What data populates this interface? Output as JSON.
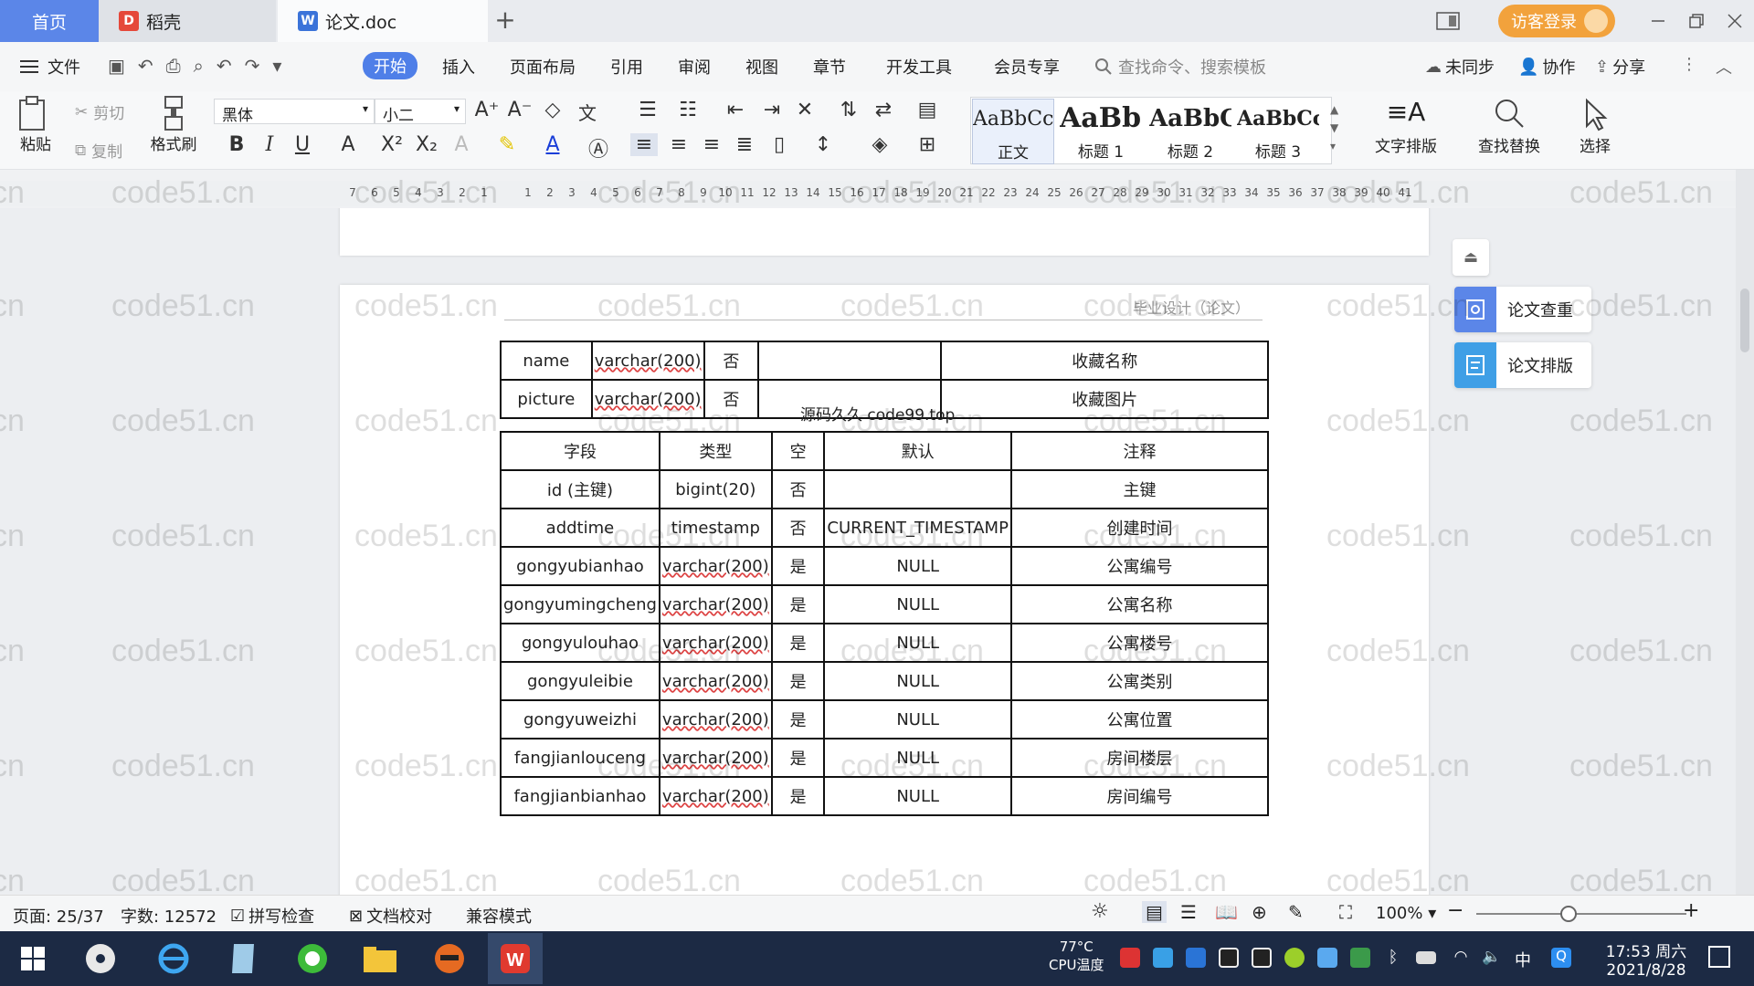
{
  "titlebar": {
    "home_tab": "首页",
    "tabs": [
      {
        "label": "稻壳",
        "icon": "daoke-icon"
      },
      {
        "label": "论文.doc",
        "icon": "word-doc-icon"
      }
    ],
    "new_tab": "+",
    "visitor_login": "访客登录"
  },
  "menu": {
    "file": "文件",
    "items": [
      "开始",
      "插入",
      "页面布局",
      "引用",
      "审阅",
      "视图",
      "章节",
      "开发工具",
      "会员专享"
    ],
    "search_placeholder": "查找命令、搜索模板",
    "sync": "未同步",
    "collab": "协作",
    "share": "分享"
  },
  "ribbon": {
    "paste": "粘贴",
    "cut": "剪切",
    "copy": "复制",
    "format_painter": "格式刷",
    "font": "黑体",
    "size": "小二",
    "styles": [
      {
        "preview": "AaBbCcI",
        "name": "正文"
      },
      {
        "preview": "AaBb(",
        "name": "标题 1"
      },
      {
        "preview": "AaBbC",
        "name": "标题 2"
      },
      {
        "preview": "AaBbCcl",
        "name": "标题 3"
      }
    ],
    "text_layout": "文字排版",
    "find_replace": "查找替换",
    "select": "选择"
  },
  "ruler": [
    "7",
    "6",
    "5",
    "4",
    "3",
    "2",
    "1",
    "",
    "1",
    "2",
    "3",
    "4",
    "5",
    "6",
    "7",
    "8",
    "9",
    "10",
    "11",
    "12",
    "13",
    "14",
    "15",
    "16",
    "17",
    "18",
    "19",
    "20",
    "21",
    "22",
    "23",
    "24",
    "25",
    "26",
    "27",
    "28",
    "29",
    "30",
    "31",
    "32",
    "33",
    "34",
    "35",
    "36",
    "37",
    "38",
    "39",
    "40",
    "41"
  ],
  "document": {
    "header": "毕业设计（论文）",
    "table1": [
      [
        "name",
        "varchar(200)",
        "否",
        "",
        "收藏名称"
      ],
      [
        "picture",
        "varchar(200)",
        "否",
        "",
        "收藏图片"
      ]
    ],
    "caption": "源码久久 code99.top",
    "table2_header": [
      "字段",
      "类型",
      "空",
      "默认",
      "注释"
    ],
    "table2": [
      [
        "id (主键)",
        "bigint(20)",
        "否",
        "",
        "主键"
      ],
      [
        "addtime",
        "timestamp",
        "否",
        "CURRENT_TIMESTAMP",
        "创建时间"
      ],
      [
        "gongyubianhao",
        "varchar(200)",
        "是",
        "NULL",
        "公寓编号"
      ],
      [
        "gongyumingcheng",
        "varchar(200)",
        "是",
        "NULL",
        "公寓名称"
      ],
      [
        "gongyulouhao",
        "varchar(200)",
        "是",
        "NULL",
        "公寓楼号"
      ],
      [
        "gongyuleibie",
        "varchar(200)",
        "是",
        "NULL",
        "公寓类别"
      ],
      [
        "gongyuweizhi",
        "varchar(200)",
        "是",
        "NULL",
        "公寓位置"
      ],
      [
        "fangjianlouceng",
        "varchar(200)",
        "是",
        "NULL",
        "房间楼层"
      ],
      [
        "fangjianbianhao",
        "varchar(200)",
        "是",
        "NULL",
        "房间编号"
      ]
    ],
    "watermark": "code51.cn"
  },
  "side_panel": {
    "check": "论文查重",
    "layout": "论文排版"
  },
  "status": {
    "page": "页面: 25/37",
    "words": "字数: 12572",
    "spell": "拼写检查",
    "proof": "文档校对",
    "compat": "兼容模式",
    "zoom": "100%"
  },
  "taskbar": {
    "temp": "77°C",
    "temp_label": "CPU温度",
    "time": "17:53 周六",
    "date": "2021/8/28",
    "ime": "中"
  },
  "colors": {
    "accent": "#4f7fe8",
    "visitor": "#f2a23c",
    "taskbar": "#1c2a44"
  }
}
